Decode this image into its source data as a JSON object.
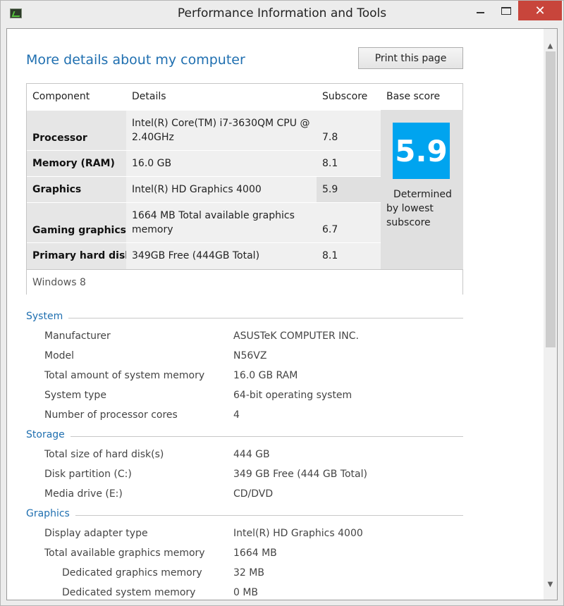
{
  "window": {
    "title": "Performance Information and Tools"
  },
  "page": {
    "heading": "More details about my computer",
    "print_button": "Print this page"
  },
  "score_table": {
    "headers": {
      "component": "Component",
      "details": "Details",
      "subscore": "Subscore",
      "base": "Base score"
    },
    "rows": [
      {
        "component": "Processor",
        "details_line1": "Intel(R) Core(TM) i7-3630QM CPU @",
        "details_line2": "2.40GHz",
        "subscore": "7.8"
      },
      {
        "component": "Memory (RAM)",
        "details_line1": "16.0 GB",
        "subscore": "8.1"
      },
      {
        "component": "Graphics",
        "details_line1": "Intel(R) HD Graphics 4000",
        "subscore": "5.9"
      },
      {
        "component": "Gaming graphics",
        "details_line1": "1664 MB Total available graphics",
        "details_line2": "memory",
        "subscore": "6.7"
      },
      {
        "component": "Primary hard disk",
        "details_line1": "349GB Free (444GB Total)",
        "subscore": "8.1"
      }
    ],
    "base_score": "5.9",
    "base_note": [
      "Determined",
      "by lowest",
      "subscore"
    ],
    "os": "Windows 8",
    "colors": {
      "score_tile": "#00a4ef"
    }
  },
  "sections": {
    "system": {
      "title": "System",
      "items": [
        {
          "label": "Manufacturer",
          "value": "ASUSTeK COMPUTER INC."
        },
        {
          "label": "Model",
          "value": "N56VZ"
        },
        {
          "label": "Total amount of system memory",
          "value": "16.0 GB RAM"
        },
        {
          "label": "System type",
          "value": "64-bit operating system"
        },
        {
          "label": "Number of processor cores",
          "value": "4"
        }
      ]
    },
    "storage": {
      "title": "Storage",
      "items": [
        {
          "label": "Total size of hard disk(s)",
          "value": "444 GB"
        },
        {
          "label": "Disk partition (C:)",
          "value": "349 GB Free (444 GB Total)"
        },
        {
          "label": "Media drive (E:)",
          "value": "CD/DVD"
        }
      ]
    },
    "graphics": {
      "title": "Graphics",
      "items": [
        {
          "label": "Display adapter type",
          "value": "Intel(R) HD Graphics 4000"
        },
        {
          "label": "Total available graphics memory",
          "value": "1664 MB"
        },
        {
          "label": "Dedicated graphics memory",
          "value": "32 MB"
        },
        {
          "label": "Dedicated system memory",
          "value": "0 MB"
        }
      ]
    }
  }
}
